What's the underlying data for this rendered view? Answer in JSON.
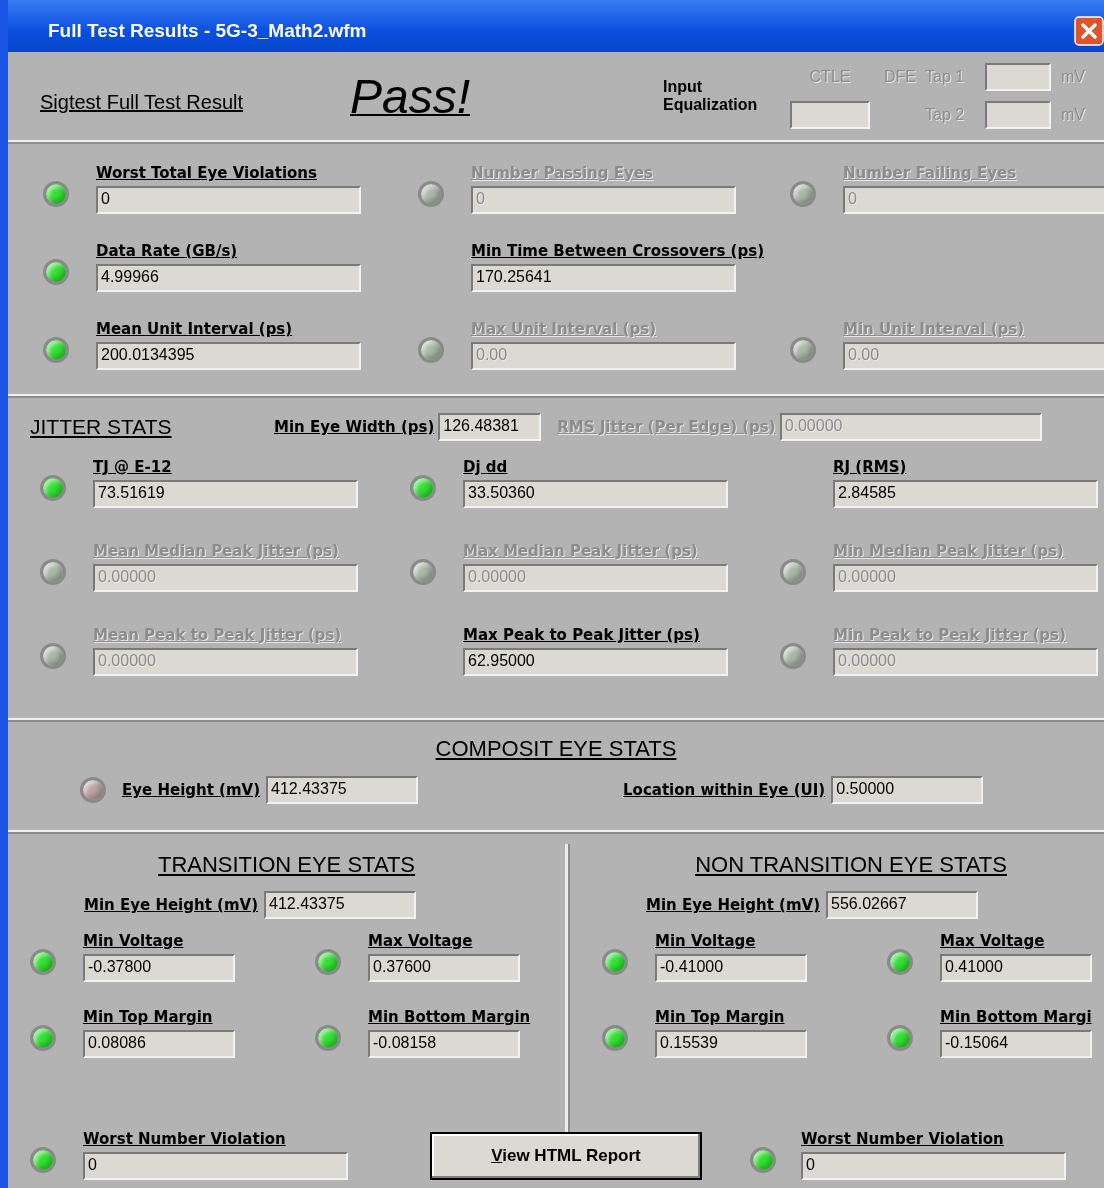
{
  "window": {
    "title": "Full Test Results - 5G-3_Math2.wfm"
  },
  "header": {
    "title": "Sigtest Full Test Result",
    "result": "Pass!",
    "equalization": {
      "label": "Input Equalization",
      "ctle": {
        "label": "CTLE",
        "disabled": true
      },
      "dfe_label": "DFE",
      "taps": [
        {
          "label": "Tap 1",
          "unit": "mV",
          "disabled": true
        },
        {
          "label": "Tap 2",
          "unit": "mV",
          "disabled": true
        }
      ]
    }
  },
  "summary": {
    "rows": [
      [
        {
          "label": "Worst Total Eye Violations",
          "value": "0",
          "color": "#33e033",
          "disabled": false
        },
        {
          "label": "Number Passing Eyes",
          "value": "0",
          "color": "#a9b8a7",
          "disabled": true
        },
        {
          "label": "Number Failing Eyes",
          "value": "0",
          "color": "#a9b8a7",
          "disabled": true
        }
      ],
      [
        {
          "label": "Data Rate (GB/s)",
          "value": "4.99966",
          "color": "#33e033",
          "disabled": false
        },
        {
          "label": "Min Time Between Crossovers (ps)",
          "value": "170.25641",
          "disabled": false
        }
      ],
      [
        {
          "label": "Mean Unit Interval (ps)",
          "value": "200.0134395",
          "color": "#33e033",
          "disabled": false
        },
        {
          "label": "Max Unit Interval (ps)",
          "value": "0.00",
          "color": "#a9b8a7",
          "disabled": true
        },
        {
          "label": "Min Unit Interval (ps)",
          "value": "0.00",
          "color": "#a9b8a7",
          "disabled": true
        }
      ]
    ]
  },
  "jitter": {
    "title": "JITTER STATS",
    "inline": [
      {
        "label": "Min Eye Width (ps)",
        "value": "126.48381",
        "disabled": false
      },
      {
        "label": "RMS Jitter (Per Edge) (ps)",
        "value": "0.00000",
        "disabled": true
      }
    ],
    "rows": [
      [
        {
          "label": "TJ @ E-12",
          "value": "73.51619",
          "color": "#33e033",
          "disabled": false
        },
        {
          "label": "Dj dd",
          "value": "33.50360",
          "color": "#33e033",
          "disabled": false
        },
        {
          "label": "RJ (RMS)",
          "value": "2.84585",
          "disabled": false
        }
      ],
      [
        {
          "label": "Mean Median Peak Jitter (ps)",
          "value": "0.00000",
          "color": "#a9b8a7",
          "disabled": true
        },
        {
          "label": "Max Median Peak Jitter (ps)",
          "value": "0.00000",
          "color": "#a9b8a7",
          "disabled": true
        },
        {
          "label": "Min Median Peak Jitter (ps)",
          "value": "0.00000",
          "color": "#a9b8a7",
          "disabled": true
        }
      ],
      [
        {
          "label": "Mean Peak to Peak Jitter (ps)",
          "value": "0.00000",
          "color": "#a9b8a7",
          "disabled": true
        },
        {
          "label": "Max Peak to Peak Jitter (ps)",
          "value": "62.95000",
          "disabled": false
        },
        {
          "label": "Min Peak to Peak Jitter (ps)",
          "value": "0.00000",
          "color": "#a9b8a7",
          "disabled": true
        }
      ]
    ]
  },
  "composite": {
    "title": "COMPOSIT EYE STATS",
    "items": [
      {
        "label": "Eye Height (mV)",
        "value": "412.43375",
        "color": "#bba2a5"
      },
      {
        "label": "Location within Eye (UI)",
        "value": "0.50000"
      }
    ]
  },
  "halves": [
    {
      "title": "TRANSITION EYE STATS",
      "min_eye_height": {
        "label": "Min Eye Height (mV)",
        "value": "412.43375"
      },
      "rows": [
        [
          {
            "label": "Min Voltage",
            "value": "-0.37800",
            "color": "#33e033",
            "disabled": false
          },
          {
            "label": "Max Voltage",
            "value": "0.37600",
            "color": "#33e033",
            "disabled": false
          }
        ],
        [
          {
            "label": "Min Top Margin",
            "value": "0.08086",
            "color": "#33e033",
            "disabled": false
          },
          {
            "label": "Min Bottom Margin",
            "value": "-0.08158",
            "color": "#33e033",
            "disabled": false
          }
        ]
      ],
      "worst": {
        "label": "Worst Number Violation",
        "value": "0",
        "color": "#33e033",
        "disabled": false
      }
    },
    {
      "title": "NON TRANSITION EYE STATS",
      "min_eye_height": {
        "label": "Min Eye Height (mV)",
        "value": "556.02667"
      },
      "rows": [
        [
          {
            "label": "Min Voltage",
            "value": "-0.41000",
            "color": "#33e033",
            "disabled": false
          },
          {
            "label": "Max Voltage",
            "value": "0.41000",
            "color": "#33e033",
            "disabled": false
          }
        ],
        [
          {
            "label": "Min Top Margin",
            "value": "0.15539",
            "color": "#33e033",
            "disabled": false
          },
          {
            "label": "Min Bottom Margi",
            "value": "-0.15064",
            "color": "#33e033",
            "disabled": false
          }
        ]
      ],
      "worst": {
        "label": "Worst Number Violation",
        "value": "0",
        "color": "#33e033",
        "disabled": false
      }
    }
  ],
  "report_button": "View HTML Report"
}
